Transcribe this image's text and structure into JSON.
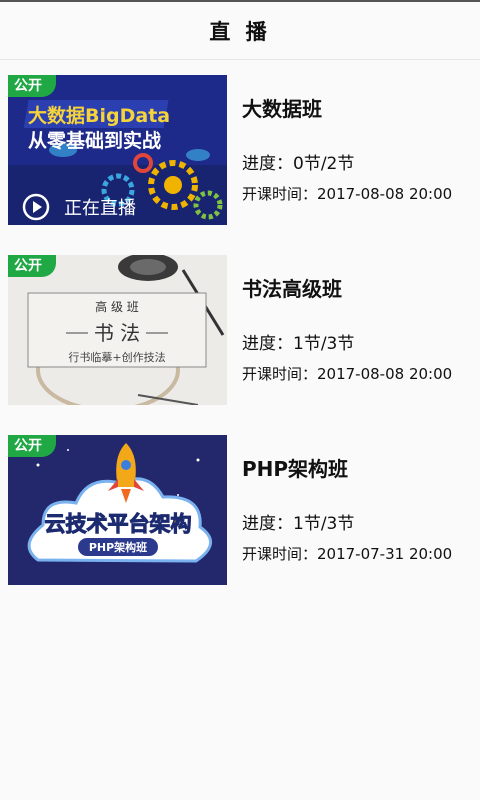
{
  "header": {
    "title": "直 播"
  },
  "courses": [
    {
      "badge": "公开",
      "title": "大数据班",
      "progress": "进度：0节/2节",
      "time": "开课时间：2017-08-08 20:00",
      "thumb": {
        "line1": "大数据BigData",
        "line2": "从零基础到实战",
        "live_label": "正在直播"
      }
    },
    {
      "badge": "公开",
      "title": "书法高级班",
      "progress": "进度：1节/3节",
      "time": "开课时间：2017-08-08 20:00",
      "thumb": {
        "line1": "高  级  班",
        "line2": "书  法",
        "line3": "行书临摹+创作技法"
      }
    },
    {
      "badge": "公开",
      "title": "PHP架构班",
      "progress": "进度：1节/3节",
      "time": "开课时间：2017-07-31 20:00",
      "thumb": {
        "line1": "云技术平台架构",
        "line2": "PHP架构班"
      }
    }
  ],
  "colors": {
    "badge": "#1fa843",
    "bigdata_bg": "#1e2a8a",
    "php_bg": "#22286b"
  },
  "icons": {
    "live": "play-circle-icon",
    "rocket": "rocket-icon",
    "gear": "gear-icon",
    "cloud": "cloud-icon"
  }
}
